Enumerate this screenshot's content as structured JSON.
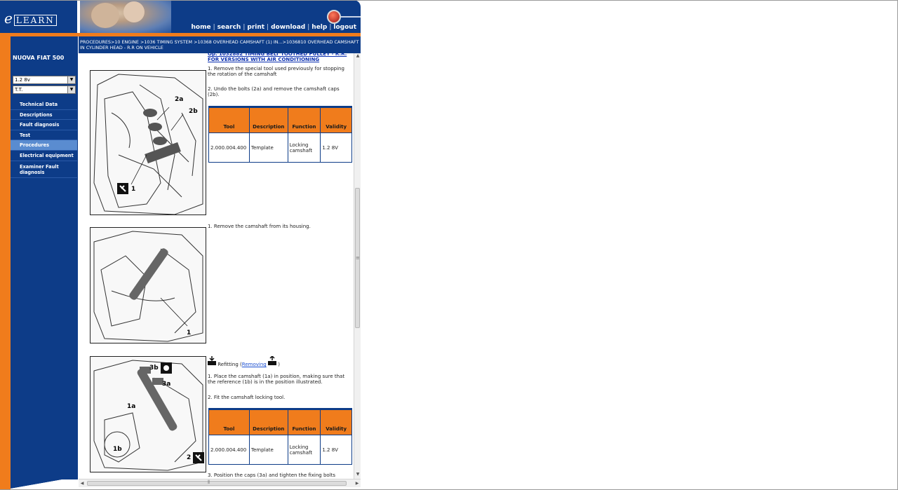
{
  "header": {
    "logo_e": "e",
    "logo_rest": "LEARN",
    "nav": [
      "home",
      "search",
      "print",
      "download",
      "help",
      "logout"
    ]
  },
  "breadcrumb": "PROCEDURES>10 ENGINE >1036 TIMING SYSTEM >10368 OVERHEAD CAMSHAFT (1) IN...>1036810 OVERHEAD CAMSHAFT IN CYLINDER HEAD - R.R ON VEHICLE",
  "sidebar": {
    "model": "NUOVA FIAT 500",
    "engine_select": "1.2 8v",
    "type_select": "T.T.",
    "menu": [
      "Technical Data",
      "Descriptions",
      "Fault diagnosis",
      "Test",
      "Procedures",
      "Electrical equipment",
      "Examiner Fault diagnosis"
    ],
    "active_index": 4
  },
  "content": {
    "op_link": "Op. 1032882 TIMING BELT TOOTHED PULLEY - R.R. FOR VERSIONS WITH AIR CONDITIONING",
    "step1a": "1. Remove the special tool used previously for stopping the rotation of the camshaft",
    "step1b": "2. Undo the bolts (2a) and remove the camshaft caps (2b).",
    "step2": "1. Remove the camshaft from its housing.",
    "refitting_label": "Refitting (",
    "removing_link": "Removing",
    "refitting_close": ")",
    "step3a": "1. Place the camshaft (1a) in position, making sure that the reference (1b) is in the position illustrated.",
    "step3b": "2. Fit the camshaft locking tool.",
    "step3c": "3. Position the caps (3a) and tighten the fixing bolts",
    "table_headers": [
      "Tool",
      "Description",
      "Function",
      "Validity"
    ],
    "table_row": [
      "2.000.004.400",
      "Template",
      "Locking camshaft",
      "1.2 8V"
    ],
    "fig1_labels": [
      "2a",
      "2b",
      "1"
    ],
    "fig2_labels": [
      "1"
    ],
    "fig3_labels": [
      "3b",
      "3a",
      "1a",
      "1b",
      "2"
    ]
  },
  "colors": {
    "brand_blue": "#0d3c88",
    "brand_orange": "#f07c1c",
    "active_menu": "#5a8cd0"
  }
}
